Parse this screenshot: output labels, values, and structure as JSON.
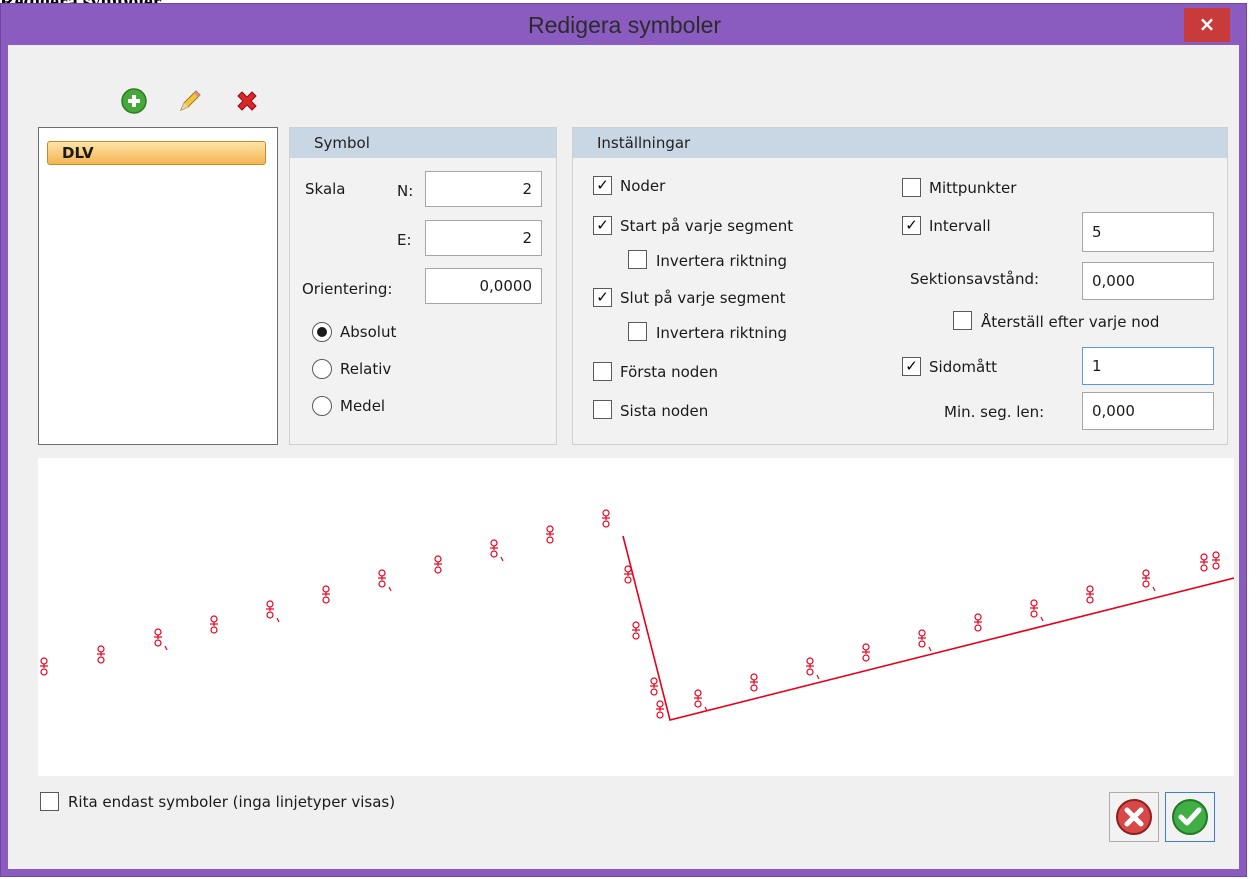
{
  "page": {
    "heading": "Redigera symboler"
  },
  "window": {
    "title": "Redigera symboler",
    "close_glyph": "×"
  },
  "toolbar": {
    "add_icon": "plus-circle-icon",
    "edit_icon": "pencil-icon",
    "delete_icon": "red-x-icon"
  },
  "symbol_list": {
    "items": [
      "DLV"
    ],
    "selected": "DLV"
  },
  "symbol": {
    "header": "Symbol",
    "scale_label": "Skala",
    "n_label": "N:",
    "n_value": "2",
    "e_label": "E:",
    "e_value": "2",
    "orientation_label": "Orientering:",
    "orientation_value": "0,0000",
    "radios": [
      "Absolut",
      "Relativ",
      "Medel"
    ],
    "selected_radio": "Absolut"
  },
  "settings": {
    "header": "Inställningar",
    "noder": {
      "label": "Noder",
      "checked": true
    },
    "start": {
      "label": "Start på varje segment",
      "checked": true
    },
    "start_invert": {
      "label": "Invertera riktning",
      "checked": false
    },
    "slut": {
      "label": "Slut på varje segment",
      "checked": true
    },
    "slut_invert": {
      "label": "Invertera riktning",
      "checked": false
    },
    "forsta": {
      "label": "Första noden",
      "checked": false
    },
    "sista": {
      "label": "Sista noden",
      "checked": false
    },
    "mittpunkter": {
      "label": "Mittpunkter",
      "checked": false
    },
    "intervall": {
      "label": "Intervall",
      "checked": true,
      "value": "5"
    },
    "sektion_label": "Sektionsavstånd:",
    "sektion_value": "0,000",
    "aterstall": {
      "label": "Återställ efter varje nod",
      "checked": false
    },
    "sidomatt": {
      "label": "Sidomått",
      "checked": true,
      "value": "1"
    },
    "minseg_label": "Min. seg. len:",
    "minseg_value": "0,000"
  },
  "bottom": {
    "draw_only_label": "Rita endast symboler (inga linjetyper visas)",
    "draw_only_checked": false
  },
  "buttons": {
    "cancel_icon": "cancel-icon",
    "ok_icon": "ok-check-icon"
  },
  "colors": {
    "title_bar": "#8a5cc0",
    "preview_line": "#e8001b",
    "panel_header": "#c9d6e4"
  }
}
